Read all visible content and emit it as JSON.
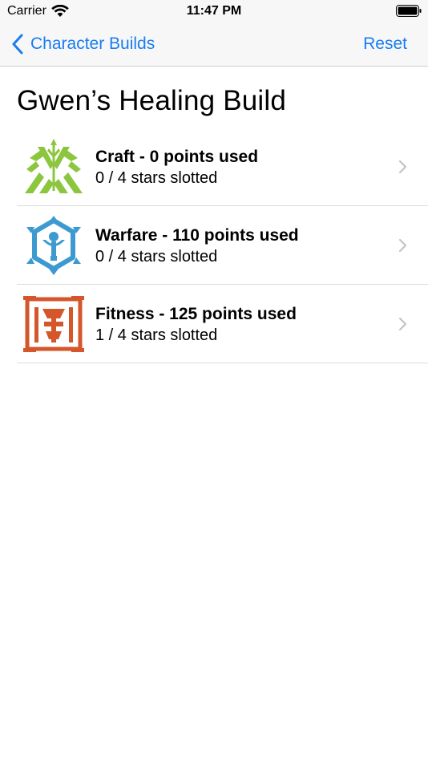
{
  "status": {
    "carrier": "Carrier",
    "time": "11:47 PM"
  },
  "nav": {
    "back_label": "Character Builds",
    "reset_label": "Reset",
    "accent": "#1a7cf2"
  },
  "page": {
    "title": "Gwen’s Healing Build"
  },
  "skills": [
    {
      "title": "Craft - 0 points used",
      "subtitle": "0 / 4 stars slotted",
      "icon": "craft-emblem-icon",
      "color": "#8cc63f"
    },
    {
      "title": "Warfare - 110 points used",
      "subtitle": "0 / 4 stars slotted",
      "icon": "warfare-emblem-icon",
      "color": "#3d9ad1"
    },
    {
      "title": "Fitness - 125 points used",
      "subtitle": "1 / 4 stars slotted",
      "icon": "fitness-emblem-icon",
      "color": "#d4562a"
    }
  ]
}
